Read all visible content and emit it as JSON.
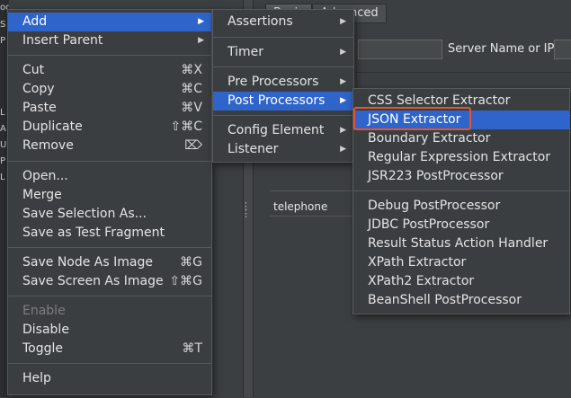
{
  "main_menu": {
    "items": [
      {
        "label": "Add",
        "submenu": true,
        "selected": true
      },
      {
        "label": "Insert Parent",
        "submenu": true
      },
      {
        "label": "Cut",
        "shortcut": "⌘X"
      },
      {
        "label": "Copy",
        "shortcut": "⌘C"
      },
      {
        "label": "Paste",
        "shortcut": "⌘V"
      },
      {
        "label": "Duplicate",
        "shortcut": "⇧⌘C"
      },
      {
        "label": "Remove",
        "shortcut": "⌦"
      },
      {
        "label": "Open..."
      },
      {
        "label": "Merge"
      },
      {
        "label": "Save Selection As..."
      },
      {
        "label": "Save as Test Fragment"
      },
      {
        "label": "Save Node As Image",
        "shortcut": "⌘G"
      },
      {
        "label": "Save Screen As Image",
        "shortcut": "⇧⌘G"
      },
      {
        "label": "Enable",
        "disabled": true
      },
      {
        "label": "Disable"
      },
      {
        "label": "Toggle",
        "shortcut": "⌘T"
      },
      {
        "label": "Help"
      }
    ]
  },
  "add_menu": {
    "items": [
      {
        "label": "Assertions",
        "submenu": true
      },
      {
        "label": "Timer",
        "submenu": true
      },
      {
        "label": "Pre Processors",
        "submenu": true
      },
      {
        "label": "Post Processors",
        "submenu": true,
        "selected": true
      },
      {
        "label": "Config Element",
        "submenu": true
      },
      {
        "label": "Listener",
        "submenu": true
      }
    ]
  },
  "post_processors_menu": {
    "items": [
      {
        "label": "CSS Selector Extractor"
      },
      {
        "label": "JSON Extractor",
        "selected": true,
        "highlighted": true
      },
      {
        "label": "Boundary Extractor"
      },
      {
        "label": "Regular Expression Extractor"
      },
      {
        "label": "JSR223 PostProcessor"
      },
      {
        "label": "Debug PostProcessor"
      },
      {
        "label": "JDBC PostProcessor"
      },
      {
        "label": "Result Status Action Handler"
      },
      {
        "label": "XPath Extractor"
      },
      {
        "label": "XPath2 Extractor"
      },
      {
        "label": "BeanShell PostProcessor"
      }
    ]
  },
  "background": {
    "tabs": [
      "Basic",
      "Advanced"
    ],
    "server_label": "Server Name or IP:",
    "table_header": "telephone",
    "left_snippets": [
      "ode",
      "S",
      "P",
      "L",
      "A",
      "U",
      "P",
      "L",
      "L",
      "L"
    ]
  },
  "colors": {
    "menu_bg": "#3b3e40",
    "selection": "#2f65ca",
    "highlight_box": "#e8542a",
    "disabled_text": "#7d7d7d"
  }
}
